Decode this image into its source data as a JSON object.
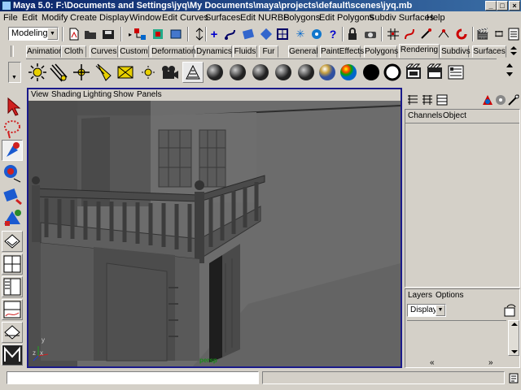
{
  "window": {
    "title": "Maya 5.0: F:\\Documents and Settings\\jyq\\My Documents\\maya\\projects\\default\\scenes\\jyq.mb",
    "minimize": "_",
    "maximize": "□",
    "close": "×"
  },
  "menubar": [
    "File",
    "Edit",
    "Modify",
    "Create",
    "Display",
    "Window",
    "Edit Curves",
    "Surfaces",
    "Edit NURBS",
    "Polygons",
    "Edit Polygons",
    "Subdiv Surfaces",
    "Help"
  ],
  "statusline": {
    "mode_value": "Modeling"
  },
  "shelf_tabs": [
    "Animation",
    "Cloth",
    "Curves",
    "Custom",
    "Deformation",
    "Dynamics",
    "Fluids",
    "Fur",
    "General",
    "PaintEffects",
    "Polygons",
    "Rendering",
    "Subdivs",
    "Surfaces"
  ],
  "shelf_active_tab": "Rendering",
  "viewport": {
    "menu": [
      "View",
      "Shading",
      "Lighting",
      "Show",
      "Panels"
    ],
    "camera_label": "persp",
    "axis_x": "x",
    "axis_y": "y",
    "axis_z": "z"
  },
  "channel_box": {
    "menu": [
      "Channels",
      "Object"
    ]
  },
  "layers": {
    "menu": [
      "Layers",
      "Options"
    ],
    "display_value": "Display",
    "scroll_left": "«",
    "scroll_right": "»"
  },
  "colors": {
    "titlebar": "#0a246a",
    "chrome": "#d4d0c8",
    "viewport_bg": "#6b6b6b",
    "viewport_border": "#1a1a8a",
    "accent_red": "#d02020"
  }
}
